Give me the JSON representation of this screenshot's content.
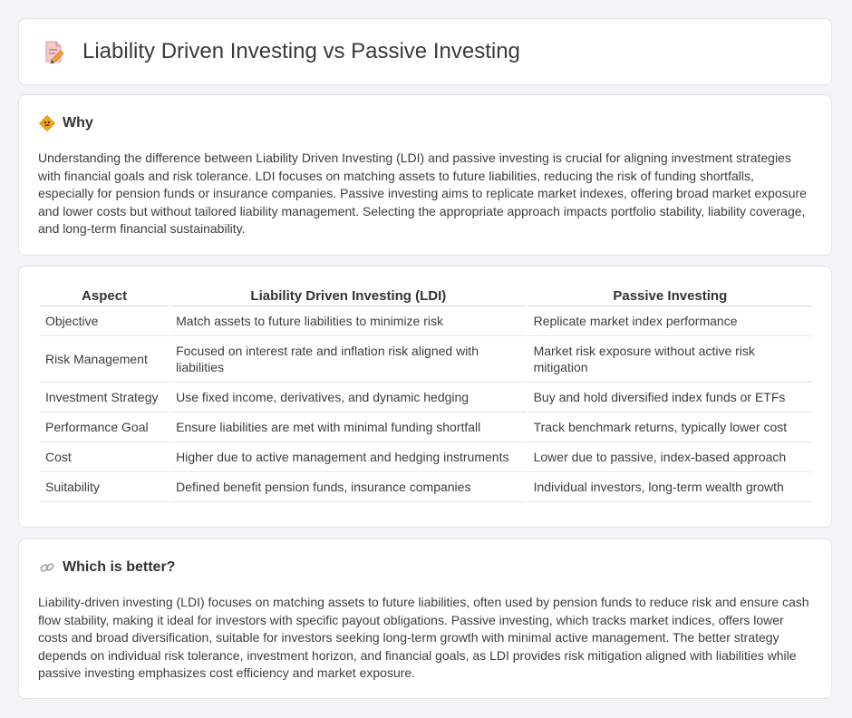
{
  "header": {
    "title": "Liability Driven Investing vs Passive Investing",
    "icon": "document-pencil-icon"
  },
  "why": {
    "title": "Why",
    "icon": "diamond-sign-icon",
    "body": "Understanding the difference between Liability Driven Investing (LDI) and passive investing is crucial for aligning investment strategies with financial goals and risk tolerance. LDI focuses on matching assets to future liabilities, reducing the risk of funding shortfalls, especially for pension funds or insurance companies. Passive investing aims to replicate market indexes, offering broad market exposure and lower costs but without tailored liability management. Selecting the appropriate approach impacts portfolio stability, liability coverage, and long-term financial sustainability."
  },
  "comparison": {
    "headers": [
      "Aspect",
      "Liability Driven Investing (LDI)",
      "Passive Investing"
    ],
    "rows": [
      [
        "Objective",
        "Match assets to future liabilities to minimize risk",
        "Replicate market index performance"
      ],
      [
        "Risk Management",
        "Focused on interest rate and inflation risk aligned with liabilities",
        "Market risk exposure without active risk mitigation"
      ],
      [
        "Investment Strategy",
        "Use fixed income, derivatives, and dynamic hedging",
        "Buy and hold diversified index funds or ETFs"
      ],
      [
        "Performance Goal",
        "Ensure liabilities are met with minimal funding shortfall",
        "Track benchmark returns, typically lower cost"
      ],
      [
        "Cost",
        "Higher due to active management and hedging instruments",
        "Lower due to passive, index-based approach"
      ],
      [
        "Suitability",
        "Defined benefit pension funds, insurance companies",
        "Individual investors, long-term wealth growth"
      ]
    ]
  },
  "better": {
    "title": "Which is better?",
    "icon": "link-icon",
    "body": "Liability-driven investing (LDI) focuses on matching assets to future liabilities, often used by pension funds to reduce risk and ensure cash flow stability, making it ideal for investors with specific payout obligations. Passive investing, which tracks market indices, offers lower costs and broad diversification, suitable for investors seeking long-term growth with minimal active management. The better strategy depends on individual risk tolerance, investment horizon, and financial goals, as LDI provides risk mitigation aligned with liabilities while passive investing emphasizes cost efficiency and market exposure."
  }
}
